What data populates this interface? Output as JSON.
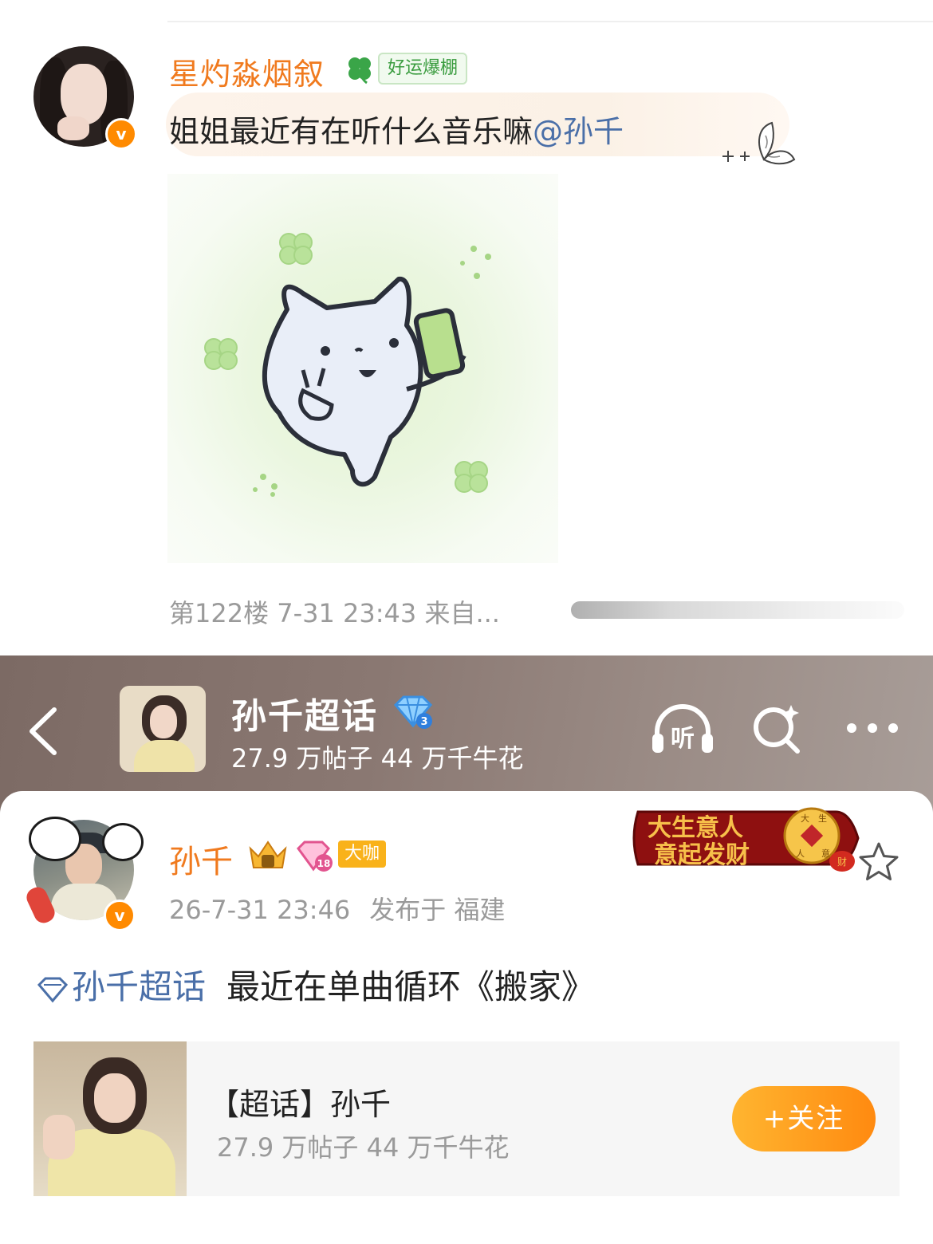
{
  "comment": {
    "username": "星灼淼烟叙",
    "badge_label": "好运爆棚",
    "text": "姐姐最近有在听什么音乐嘛",
    "mention": "@孙千",
    "meta": "第122楼 7-31 23:43 来自..."
  },
  "topic_header": {
    "title": "孙千超话",
    "stats": "27.9 万帖子 44 万千牛花",
    "diamond_level": "3",
    "listen_label": "听"
  },
  "post": {
    "username": "孙千",
    "level": "18",
    "badge_label": "大咖",
    "time": "26-7-31 23:46",
    "location_prefix": "发布于",
    "location": "福建",
    "topic_link": "孙千超话",
    "text": "最近在单曲循环《搬家》",
    "festive_badge": {
      "line1": "大生意人",
      "line2": "意起发财",
      "coin_chars": [
        "大",
        "生",
        "人",
        "意"
      ],
      "bag_char": "财"
    }
  },
  "topic_card": {
    "title": "【超话】孙千",
    "stats": "27.9 万帖子 44 万千牛花",
    "follow_label": "+关注"
  },
  "colors": {
    "username_orange": "#f07a1e",
    "link_blue": "#4a6fa8",
    "meta_gray": "#9a9a9a",
    "follow_orange": "#ff8a10",
    "verified_orange": "#ff8a00"
  },
  "icons": [
    "clover-icon",
    "butterfly-icon",
    "back-icon",
    "diamond-icon",
    "listen-icon",
    "search-icon",
    "more-icon",
    "crown-icon",
    "level-icon",
    "star-icon"
  ]
}
